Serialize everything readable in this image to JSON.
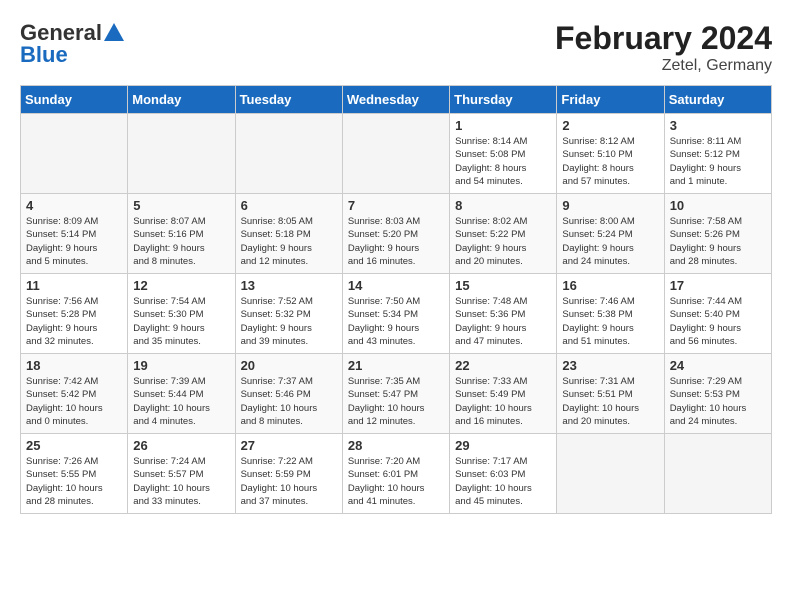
{
  "header": {
    "logo_general": "General",
    "logo_blue": "Blue",
    "title": "February 2024",
    "subtitle": "Zetel, Germany"
  },
  "weekdays": [
    "Sunday",
    "Monday",
    "Tuesday",
    "Wednesday",
    "Thursday",
    "Friday",
    "Saturday"
  ],
  "weeks": [
    [
      {
        "day": "",
        "info": ""
      },
      {
        "day": "",
        "info": ""
      },
      {
        "day": "",
        "info": ""
      },
      {
        "day": "",
        "info": ""
      },
      {
        "day": "1",
        "info": "Sunrise: 8:14 AM\nSunset: 5:08 PM\nDaylight: 8 hours\nand 54 minutes."
      },
      {
        "day": "2",
        "info": "Sunrise: 8:12 AM\nSunset: 5:10 PM\nDaylight: 8 hours\nand 57 minutes."
      },
      {
        "day": "3",
        "info": "Sunrise: 8:11 AM\nSunset: 5:12 PM\nDaylight: 9 hours\nand 1 minute."
      }
    ],
    [
      {
        "day": "4",
        "info": "Sunrise: 8:09 AM\nSunset: 5:14 PM\nDaylight: 9 hours\nand 5 minutes."
      },
      {
        "day": "5",
        "info": "Sunrise: 8:07 AM\nSunset: 5:16 PM\nDaylight: 9 hours\nand 8 minutes."
      },
      {
        "day": "6",
        "info": "Sunrise: 8:05 AM\nSunset: 5:18 PM\nDaylight: 9 hours\nand 12 minutes."
      },
      {
        "day": "7",
        "info": "Sunrise: 8:03 AM\nSunset: 5:20 PM\nDaylight: 9 hours\nand 16 minutes."
      },
      {
        "day": "8",
        "info": "Sunrise: 8:02 AM\nSunset: 5:22 PM\nDaylight: 9 hours\nand 20 minutes."
      },
      {
        "day": "9",
        "info": "Sunrise: 8:00 AM\nSunset: 5:24 PM\nDaylight: 9 hours\nand 24 minutes."
      },
      {
        "day": "10",
        "info": "Sunrise: 7:58 AM\nSunset: 5:26 PM\nDaylight: 9 hours\nand 28 minutes."
      }
    ],
    [
      {
        "day": "11",
        "info": "Sunrise: 7:56 AM\nSunset: 5:28 PM\nDaylight: 9 hours\nand 32 minutes."
      },
      {
        "day": "12",
        "info": "Sunrise: 7:54 AM\nSunset: 5:30 PM\nDaylight: 9 hours\nand 35 minutes."
      },
      {
        "day": "13",
        "info": "Sunrise: 7:52 AM\nSunset: 5:32 PM\nDaylight: 9 hours\nand 39 minutes."
      },
      {
        "day": "14",
        "info": "Sunrise: 7:50 AM\nSunset: 5:34 PM\nDaylight: 9 hours\nand 43 minutes."
      },
      {
        "day": "15",
        "info": "Sunrise: 7:48 AM\nSunset: 5:36 PM\nDaylight: 9 hours\nand 47 minutes."
      },
      {
        "day": "16",
        "info": "Sunrise: 7:46 AM\nSunset: 5:38 PM\nDaylight: 9 hours\nand 51 minutes."
      },
      {
        "day": "17",
        "info": "Sunrise: 7:44 AM\nSunset: 5:40 PM\nDaylight: 9 hours\nand 56 minutes."
      }
    ],
    [
      {
        "day": "18",
        "info": "Sunrise: 7:42 AM\nSunset: 5:42 PM\nDaylight: 10 hours\nand 0 minutes."
      },
      {
        "day": "19",
        "info": "Sunrise: 7:39 AM\nSunset: 5:44 PM\nDaylight: 10 hours\nand 4 minutes."
      },
      {
        "day": "20",
        "info": "Sunrise: 7:37 AM\nSunset: 5:46 PM\nDaylight: 10 hours\nand 8 minutes."
      },
      {
        "day": "21",
        "info": "Sunrise: 7:35 AM\nSunset: 5:47 PM\nDaylight: 10 hours\nand 12 minutes."
      },
      {
        "day": "22",
        "info": "Sunrise: 7:33 AM\nSunset: 5:49 PM\nDaylight: 10 hours\nand 16 minutes."
      },
      {
        "day": "23",
        "info": "Sunrise: 7:31 AM\nSunset: 5:51 PM\nDaylight: 10 hours\nand 20 minutes."
      },
      {
        "day": "24",
        "info": "Sunrise: 7:29 AM\nSunset: 5:53 PM\nDaylight: 10 hours\nand 24 minutes."
      }
    ],
    [
      {
        "day": "25",
        "info": "Sunrise: 7:26 AM\nSunset: 5:55 PM\nDaylight: 10 hours\nand 28 minutes."
      },
      {
        "day": "26",
        "info": "Sunrise: 7:24 AM\nSunset: 5:57 PM\nDaylight: 10 hours\nand 33 minutes."
      },
      {
        "day": "27",
        "info": "Sunrise: 7:22 AM\nSunset: 5:59 PM\nDaylight: 10 hours\nand 37 minutes."
      },
      {
        "day": "28",
        "info": "Sunrise: 7:20 AM\nSunset: 6:01 PM\nDaylight: 10 hours\nand 41 minutes."
      },
      {
        "day": "29",
        "info": "Sunrise: 7:17 AM\nSunset: 6:03 PM\nDaylight: 10 hours\nand 45 minutes."
      },
      {
        "day": "",
        "info": ""
      },
      {
        "day": "",
        "info": ""
      }
    ]
  ]
}
